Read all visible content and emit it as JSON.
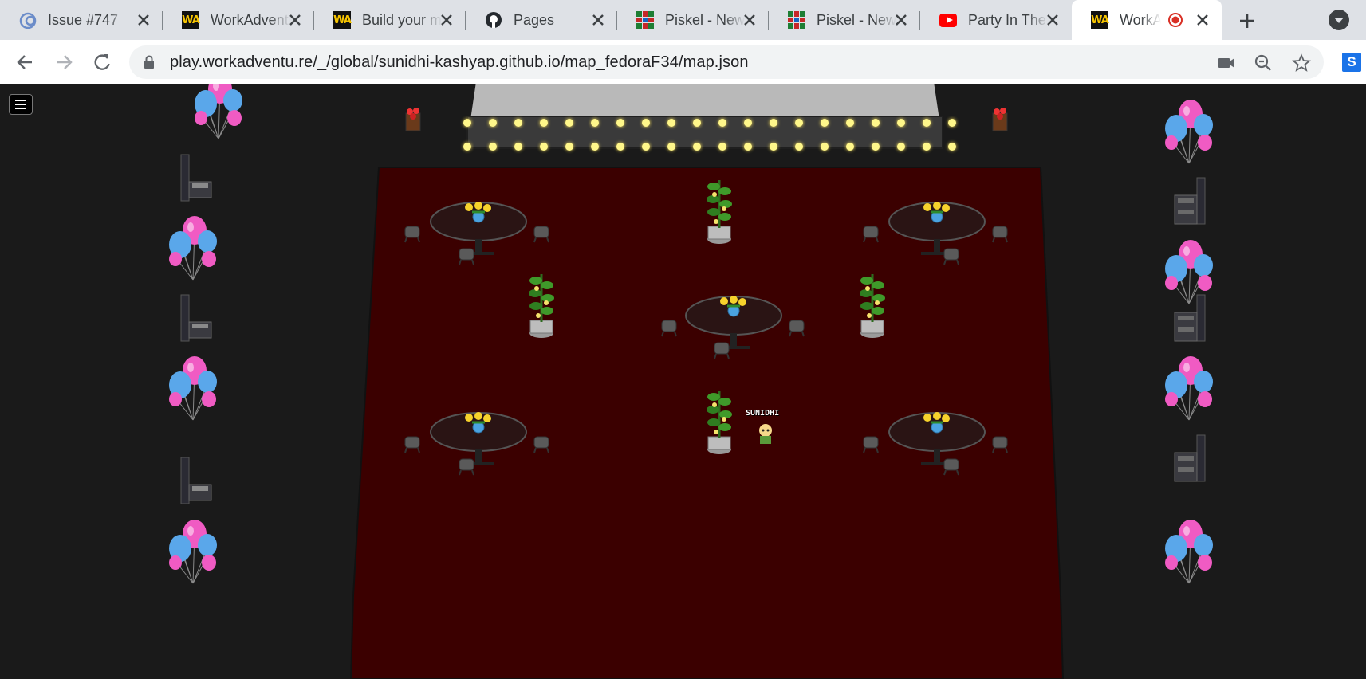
{
  "browser": {
    "tabs": [
      {
        "title": "Issue #747",
        "icon": "zenhub-icon",
        "active": false
      },
      {
        "title": "WorkAdventure",
        "icon": "workadventure-icon",
        "active": false
      },
      {
        "title": "Build your map",
        "icon": "workadventure-icon",
        "active": false
      },
      {
        "title": "Pages",
        "icon": "github-icon",
        "active": false
      },
      {
        "title": "Piskel - New",
        "icon": "piskel-icon",
        "active": false
      },
      {
        "title": "Piskel - New",
        "icon": "piskel-icon",
        "active": false
      },
      {
        "title": "Party In The",
        "icon": "youtube-icon",
        "active": false
      },
      {
        "title": "WorkAdventure",
        "icon": "workadventure-icon",
        "active": true,
        "recording": true
      }
    ],
    "url": "play.workadventu.re/_/global/sunidhi-kashyap.github.io/map_fedoraF34/map.json",
    "extension_label": "S",
    "wa_logo_text": "WA"
  },
  "game": {
    "player_name": "SUNIDHI",
    "colors": {
      "background": "#1a1a1a",
      "carpet": "#3b0000",
      "stage": "#c8c8c8",
      "lights": "#fff78a",
      "table": "#2a1414"
    }
  }
}
